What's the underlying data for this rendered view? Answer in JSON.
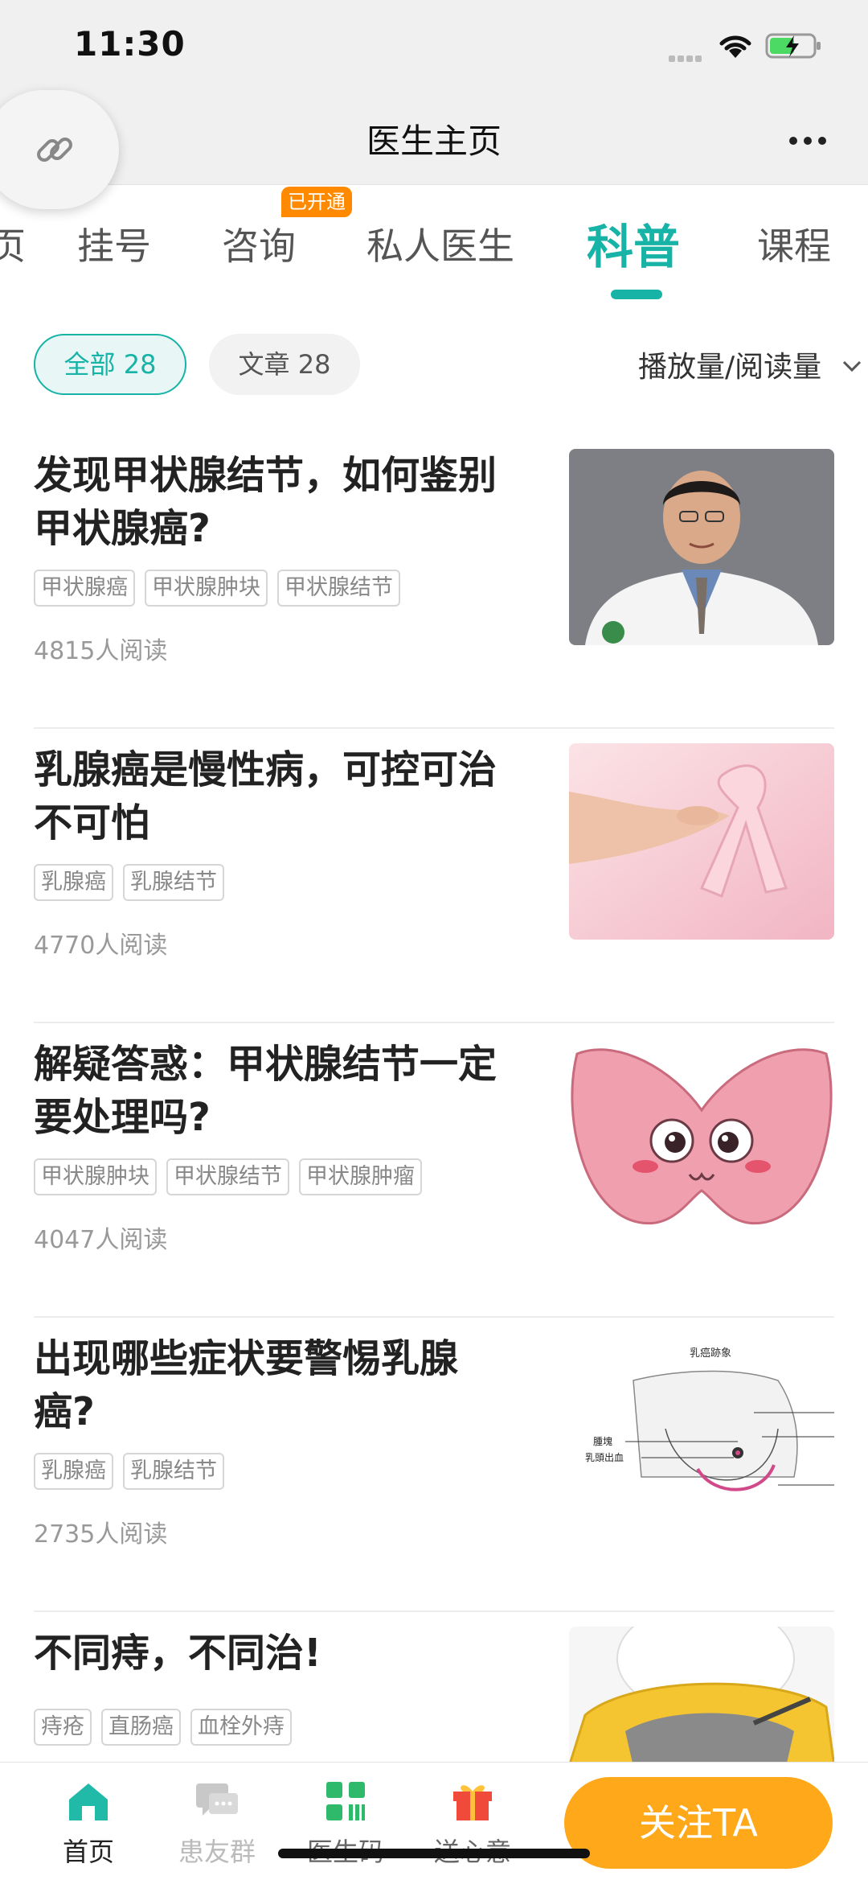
{
  "status": {
    "time": "11:30"
  },
  "nav": {
    "title": "医生主页"
  },
  "tabs": [
    {
      "label": "页"
    },
    {
      "label": "挂号"
    },
    {
      "label": "咨询",
      "badge": "已开通"
    },
    {
      "label": "私人医生"
    },
    {
      "label": "科普"
    },
    {
      "label": "课程"
    }
  ],
  "filters": {
    "all": "全部 28",
    "article": "文章 28",
    "sort": "播放量/阅读量"
  },
  "articles": [
    {
      "title": "发现甲状腺结节，如何鉴别甲状腺癌?",
      "tags": [
        "甲状腺癌",
        "甲状腺肿块",
        "甲状腺结节"
      ],
      "reads": "4815人阅读",
      "image": "doctor-portrait"
    },
    {
      "title": "乳腺癌是慢性病，可控可治不可怕",
      "tags": [
        "乳腺癌",
        "乳腺结节"
      ],
      "reads": "4770人阅读",
      "image": "pink-ribbon"
    },
    {
      "title": "解疑答惑：甲状腺结节一定要处理吗?",
      "tags": [
        "甲状腺肿块",
        "甲状腺结节",
        "甲状腺肿瘤"
      ],
      "reads": "4047人阅读",
      "image": "cartoon-thyroid"
    },
    {
      "title": "出现哪些症状要警惕乳腺癌?",
      "tags": [
        "乳腺癌",
        "乳腺结节"
      ],
      "reads": "2735人阅读",
      "image": "breast-diagram",
      "diagram": {
        "title": "乳癌跡象",
        "label1": "腫塊",
        "label2": "乳頭出血"
      }
    },
    {
      "title": "不同痔，不同治!",
      "tags": [
        "痔疮",
        "直肠癌",
        "血栓外痔"
      ],
      "reads": "",
      "image": "toilet-illustration"
    }
  ],
  "bottom_nav": {
    "home": "首页",
    "group": "患友群",
    "code": "医生码",
    "gift": "送心意",
    "follow": "关注TA"
  },
  "colors": {
    "accent": "#17b3a6",
    "orange": "#ffa81a",
    "badge": "#ff8a00"
  }
}
